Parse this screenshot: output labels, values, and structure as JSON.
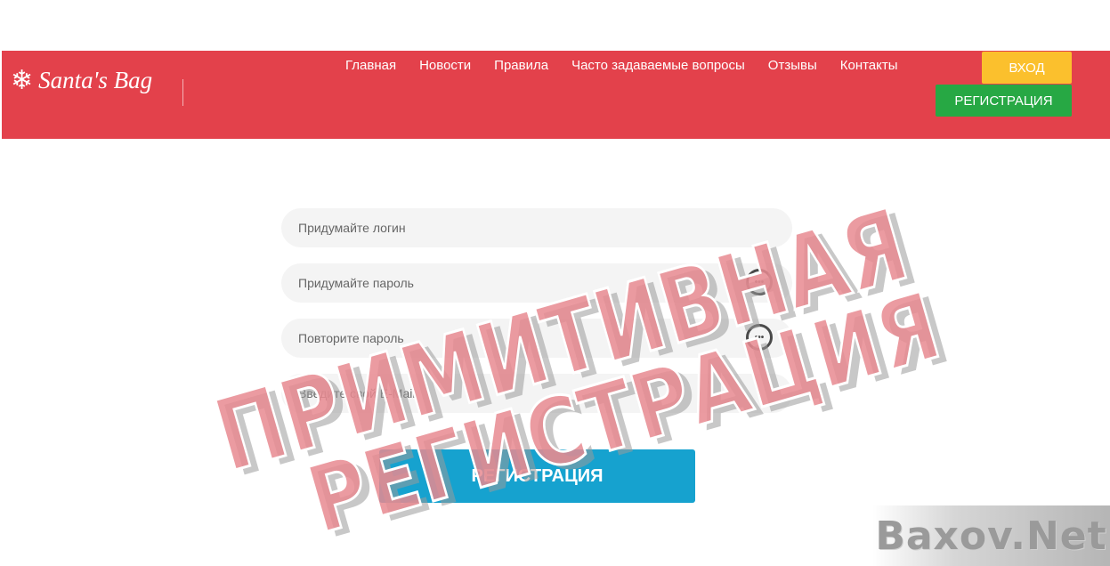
{
  "header": {
    "logo_text": "Santa's Bag",
    "nav": [
      "Главная",
      "Новости",
      "Правила",
      "Часто задаваемые вопросы",
      "Отзывы",
      "Контакты"
    ],
    "login_label": "ВХОД",
    "register_label": "РЕГИСТРАЦИЯ"
  },
  "form": {
    "login_placeholder": "Придумайте логин",
    "password_placeholder": "Придумайте пароль",
    "repeat_password_placeholder": "Повторите пароль",
    "email_placeholder": "Введите свой E-Mail",
    "submit_label": "РЕГИСТРАЦИЯ"
  },
  "stamp": {
    "line1": "ПРИМИТИВНАЯ",
    "line2": "РЕГИСТРАЦИЯ"
  },
  "watermark": "Baxov.Net",
  "colors": {
    "header_bg": "#e3414b",
    "login_btn": "#fbc02d",
    "register_btn": "#27a844",
    "submit_btn": "#16a2cf",
    "stamp": "#e88a90"
  }
}
